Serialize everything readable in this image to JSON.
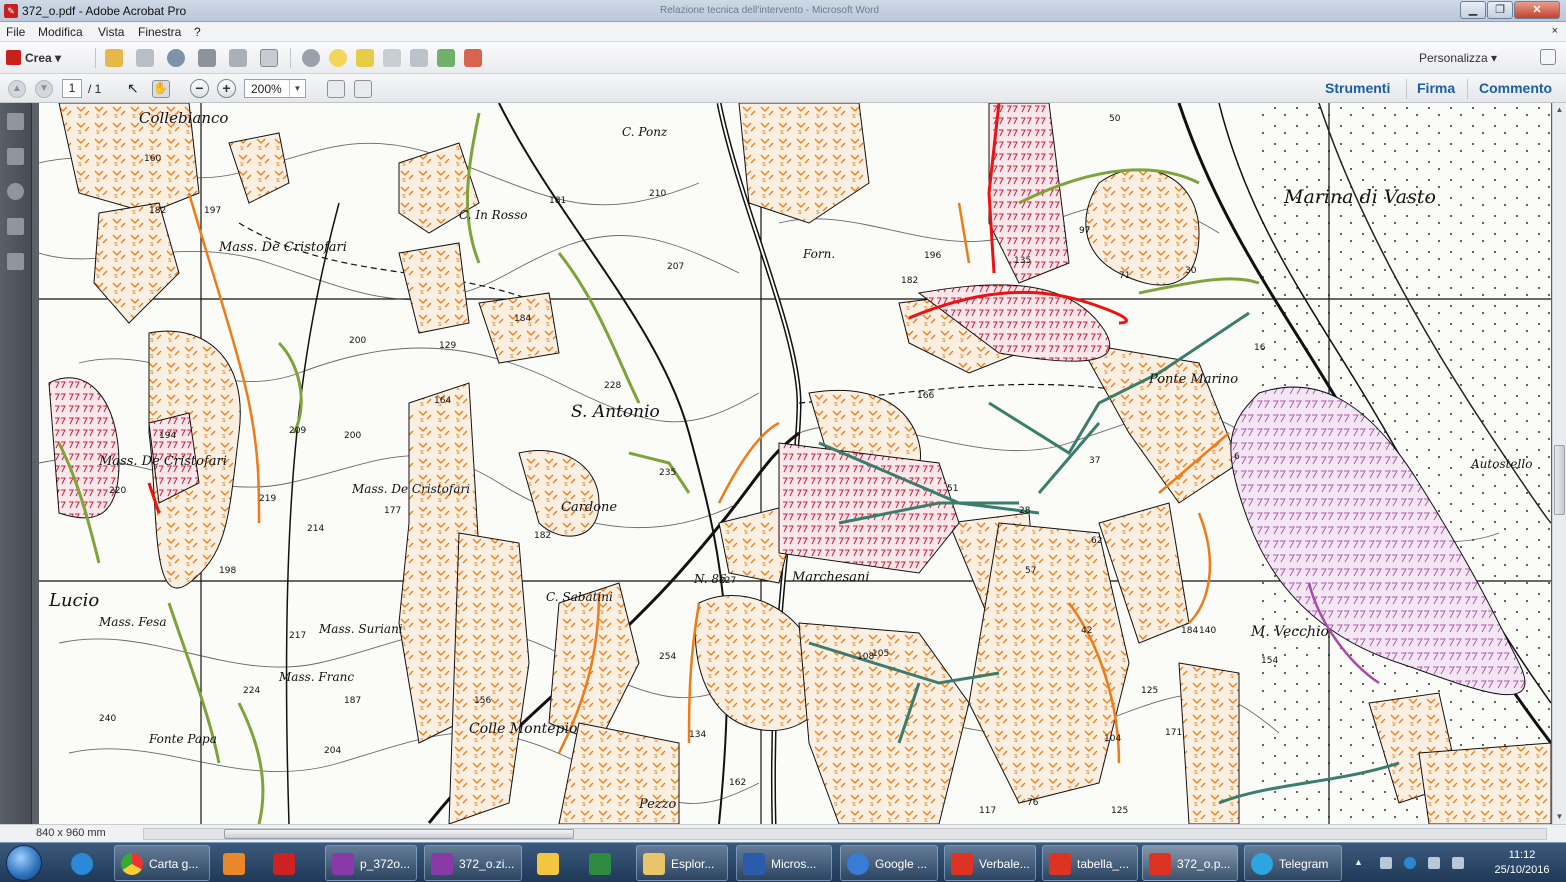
{
  "window": {
    "title": "372_o.pdf - Adobe Acrobat Pro",
    "background_title": "Relazione tecnica dell'intervento - Microsoft Word",
    "controls": {
      "minimize": "▁",
      "restore": "❐",
      "close": "✕"
    }
  },
  "menu": {
    "items": [
      "File",
      "Modifica",
      "Vista",
      "Finestra",
      "?"
    ],
    "close_doc": "×"
  },
  "toolbar": {
    "crea_label": "Crea",
    "personalizza_label": "Personalizza",
    "icons": [
      "open-icon",
      "save-icon",
      "upload-icon",
      "print-icon",
      "edit-icon",
      "email-icon",
      "settings-icon",
      "comment-icon",
      "highlight-icon",
      "stamp-icon",
      "attach-icon",
      "export-icon",
      "fill-sign-icon"
    ]
  },
  "nav": {
    "page_current": "1",
    "page_total": "/ 1",
    "zoom": "200%",
    "right_links": [
      "Strumenti",
      "Firma",
      "Commento"
    ]
  },
  "map": {
    "labels": [
      "Collebianco",
      "Mass. De Cristofari",
      "C. In Rosso",
      "C. Ponz",
      "Forn.",
      "Marina di Vasto",
      "S. Antonio",
      "Mass. De Cristofari",
      "Mass. De Cristofari",
      "Cardone",
      "Marchesani",
      "C. Sabatini",
      "Mass. Fesa",
      "Mass. Suriani",
      "Mass. Franc",
      "Colle Montepio",
      "M. Vecchio",
      "Autostello",
      "Lucio",
      "Ponte Marino",
      "N. 86",
      "Fonte Papa",
      "Pezzo"
    ],
    "spot_heights": [
      "197",
      "182",
      "160",
      "200",
      "209",
      "200",
      "194",
      "220",
      "219",
      "214",
      "177",
      "198",
      "129",
      "164",
      "181",
      "210",
      "207",
      "184",
      "228",
      "235",
      "227",
      "182",
      "254",
      "156",
      "134",
      "162",
      "217",
      "240",
      "204",
      "187",
      "224",
      "196",
      "182",
      "166",
      "51",
      "28",
      "37",
      "62",
      "57",
      "42",
      "105",
      "117",
      "104",
      "125",
      "140",
      "184",
      "154",
      "171",
      "76",
      "125",
      "71",
      "30",
      "6",
      "16",
      "97",
      "50",
      "135",
      "108"
    ]
  },
  "status": {
    "page_size": "840 x 960 mm"
  },
  "taskbar": {
    "items": [
      {
        "label": "",
        "icon": "ie-icon"
      },
      {
        "label": "Carta g...",
        "icon": "chrome-icon"
      },
      {
        "label": "",
        "icon": "media-player-icon"
      },
      {
        "label": "",
        "icon": "acrobat-reader-icon"
      },
      {
        "label": "p_372o...",
        "icon": "winrar-icon"
      },
      {
        "label": "372_o.zi...",
        "icon": "winrar-icon"
      },
      {
        "label": "",
        "icon": "outlook-icon"
      },
      {
        "label": "",
        "icon": "excel-icon"
      },
      {
        "label": "Esplor...",
        "icon": "folder-icon"
      },
      {
        "label": "Micros...",
        "icon": "word-icon"
      },
      {
        "label": "Google ...",
        "icon": "google-earth-icon"
      },
      {
        "label": "Verbale...",
        "icon": "pdf-icon"
      },
      {
        "label": "tabella_...",
        "icon": "pdf-icon"
      },
      {
        "label": "372_o.p...",
        "icon": "pdf-icon"
      },
      {
        "label": "Telegram",
        "icon": "telegram-icon"
      }
    ],
    "time": "11:12",
    "date": "25/10/2016"
  }
}
